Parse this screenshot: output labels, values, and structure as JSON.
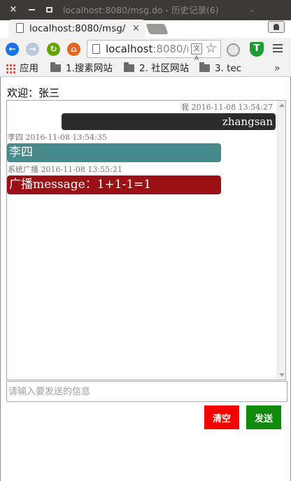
{
  "window": {
    "title": "localhost:8080/msg.do - 历史记录(6)",
    "controls": {
      "close_glyph": "×",
      "minimize_glyph": "–",
      "maximize_glyph": "□"
    }
  },
  "tab": {
    "title": "localhost:8080/msg/",
    "close_glyph": "×"
  },
  "toolbar": {
    "url_host": "localhost",
    "url_rest": ":8080/m",
    "translate_glyph": "文A",
    "star_glyph": "☆",
    "back_glyph": "←",
    "forward_glyph": "→",
    "reload_glyph": "↻",
    "home_glyph": "⌂",
    "ext2_glyph": "T"
  },
  "bookmarks": {
    "items": [
      {
        "label": "应用",
        "icon": "apps-grid-icon"
      },
      {
        "label": "1.搜素网站",
        "icon": "folder-icon"
      },
      {
        "label": "2. 社区网站",
        "icon": "folder-icon"
      },
      {
        "label": "3. tec",
        "icon": "folder-icon"
      }
    ],
    "more_glyph": "»"
  },
  "page": {
    "welcome_label": "欢迎：",
    "username": "张三",
    "messages": [
      {
        "sender": "我",
        "time": "2016-11-08 13:54:27",
        "text": "zhangsan",
        "color": "#2b2b2b",
        "align": "right"
      },
      {
        "sender": "李四",
        "time": "2016-11-08 13:54:35",
        "text": "李四",
        "color": "#468a8b",
        "align": "left"
      },
      {
        "sender": "系统广播",
        "time": "2016-11-08 13:55:21",
        "text": "广播message：1+1-1=1",
        "color": "#9a1014",
        "align": "left"
      }
    ],
    "input_placeholder": "请输入要发送的信息",
    "input_value": "",
    "clear_label": "清空",
    "send_label": "发送"
  },
  "colors": {
    "clear_button": "#f40000",
    "send_button": "#118a0c",
    "titlebar": "#3b3a37"
  }
}
